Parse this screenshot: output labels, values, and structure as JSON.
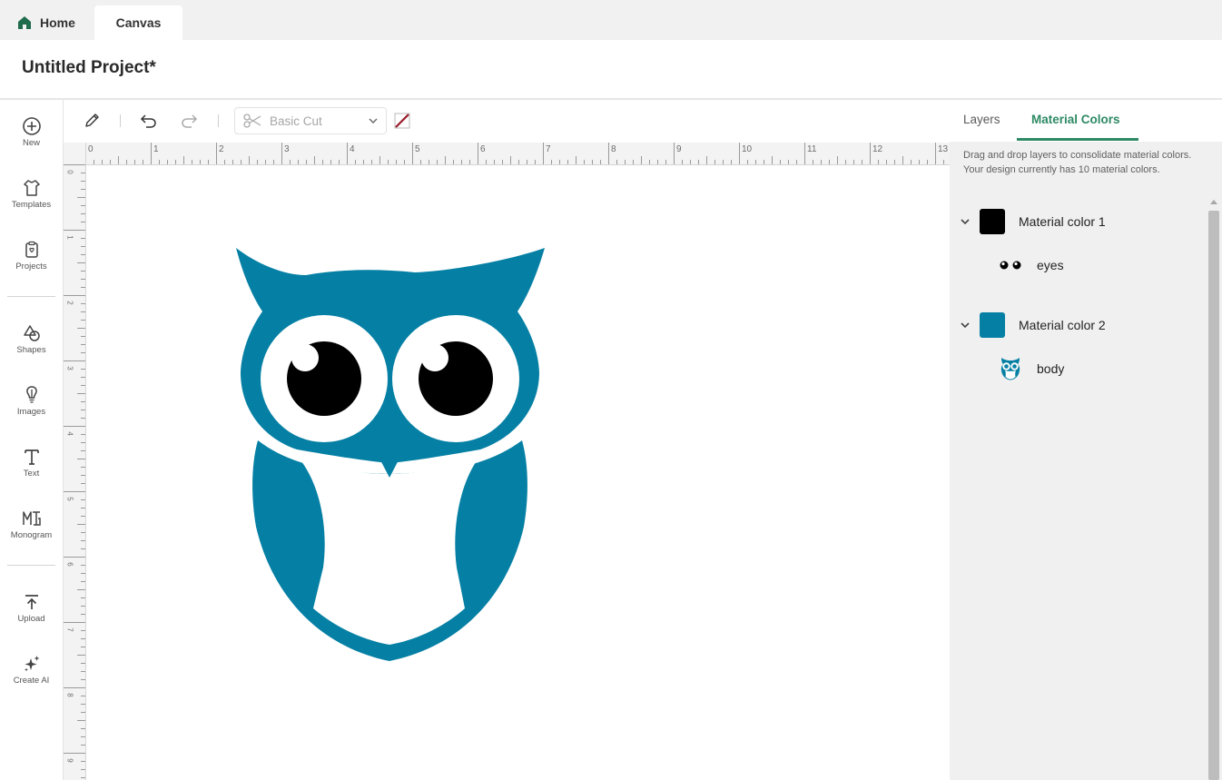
{
  "tabs": {
    "home_label": "Home",
    "canvas_label": "Canvas"
  },
  "project": {
    "title": "Untitled Project*"
  },
  "sidebar": {
    "items": [
      {
        "label": "New",
        "icon": "plus-circle-icon"
      },
      {
        "label": "Templates",
        "icon": "tshirt-icon"
      },
      {
        "label": "Projects",
        "icon": "projects-icon"
      },
      {
        "label": "Shapes",
        "icon": "shapes-icon"
      },
      {
        "label": "Images",
        "icon": "lightbulb-icon"
      },
      {
        "label": "Text",
        "icon": "text-icon"
      },
      {
        "label": "Monogram",
        "icon": "monogram-icon"
      },
      {
        "label": "Upload",
        "icon": "upload-icon"
      },
      {
        "label": "Create AI",
        "icon": "sparkle-icon"
      }
    ]
  },
  "toolbar": {
    "operation": "Basic Cut"
  },
  "rulers": {
    "top": [
      "0",
      "1",
      "2",
      "3",
      "4",
      "5",
      "6",
      "7",
      "8",
      "9",
      "10",
      "11",
      "12",
      "13"
    ],
    "left": [
      "0",
      "1",
      "2",
      "3",
      "4",
      "5",
      "6",
      "7",
      "8",
      "9"
    ]
  },
  "panel": {
    "tab_layers": "Layers",
    "tab_material_colors": "Material Colors",
    "description": "Drag and drop layers to consolidate material colors. Your design currently has 10 material colors.",
    "groups": [
      {
        "label": "Material color 1",
        "color": "#000000",
        "layers": [
          {
            "label": "eyes"
          }
        ]
      },
      {
        "label": "Material color 2",
        "color": "#0580a4",
        "layers": [
          {
            "label": "body"
          }
        ]
      }
    ]
  },
  "colors": {
    "accent": "#2e8a64",
    "owl": "#0580a4",
    "home_icon": "#1f6b4d"
  }
}
